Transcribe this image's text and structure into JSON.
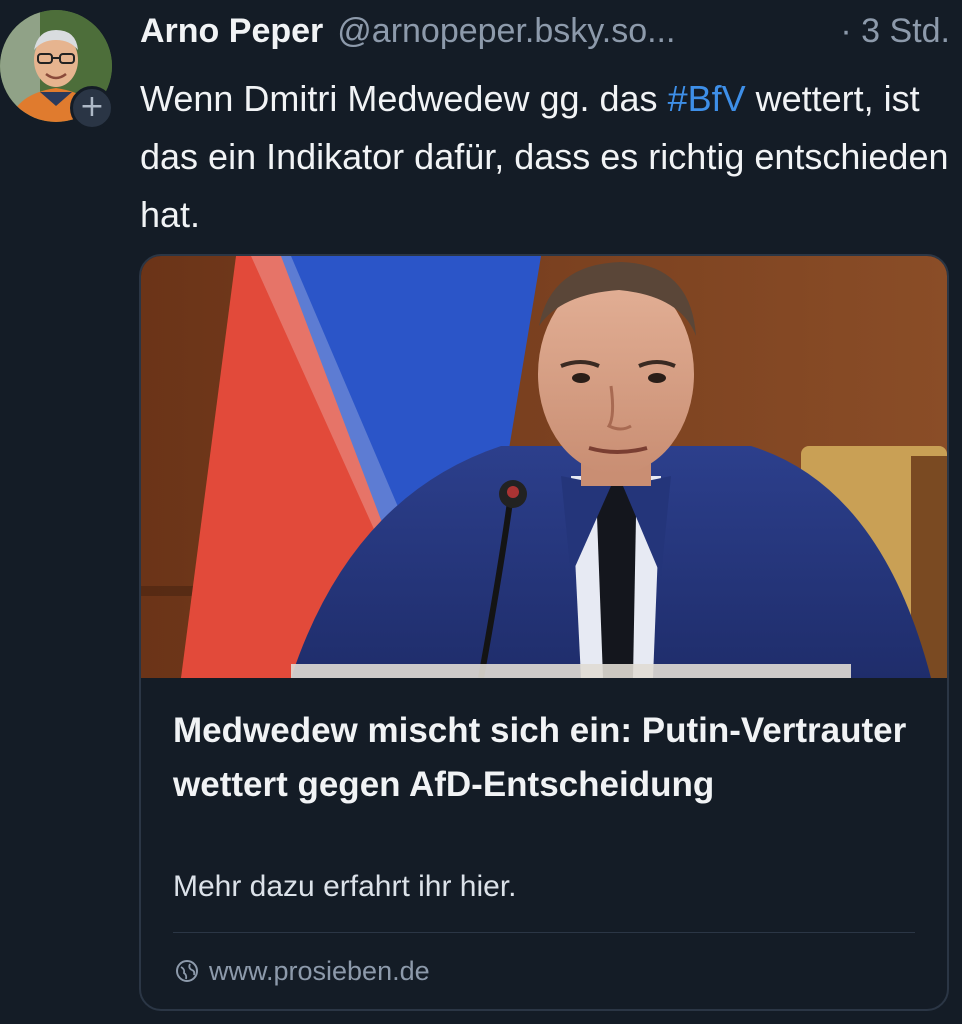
{
  "post": {
    "author": {
      "name": "Arno Peper",
      "handle": "@arnopeper.bsky.so...",
      "follow_badge": "+"
    },
    "time": "· 3 Std.",
    "text": {
      "part1": "Wenn Dmitri Medwedew gg. das ",
      "hashtag": "#BfV",
      "part2": " wettert, ist das ein Indikator dafür, dass es richtig entschieden hat."
    },
    "link_card": {
      "title": "Medwedew mischt sich ein: Putin-Vertrauter wettert gegen AfD-Entscheidung",
      "description": "Mehr dazu erfahrt ihr hier.",
      "domain": "www.prosieben.de",
      "domain_icon": "globe-icon"
    }
  },
  "colors": {
    "background": "#141c26",
    "text": "#f1f3f5",
    "muted": "#8d9aab",
    "hashtag": "#3e8fe8",
    "card_border": "#2b3645"
  }
}
